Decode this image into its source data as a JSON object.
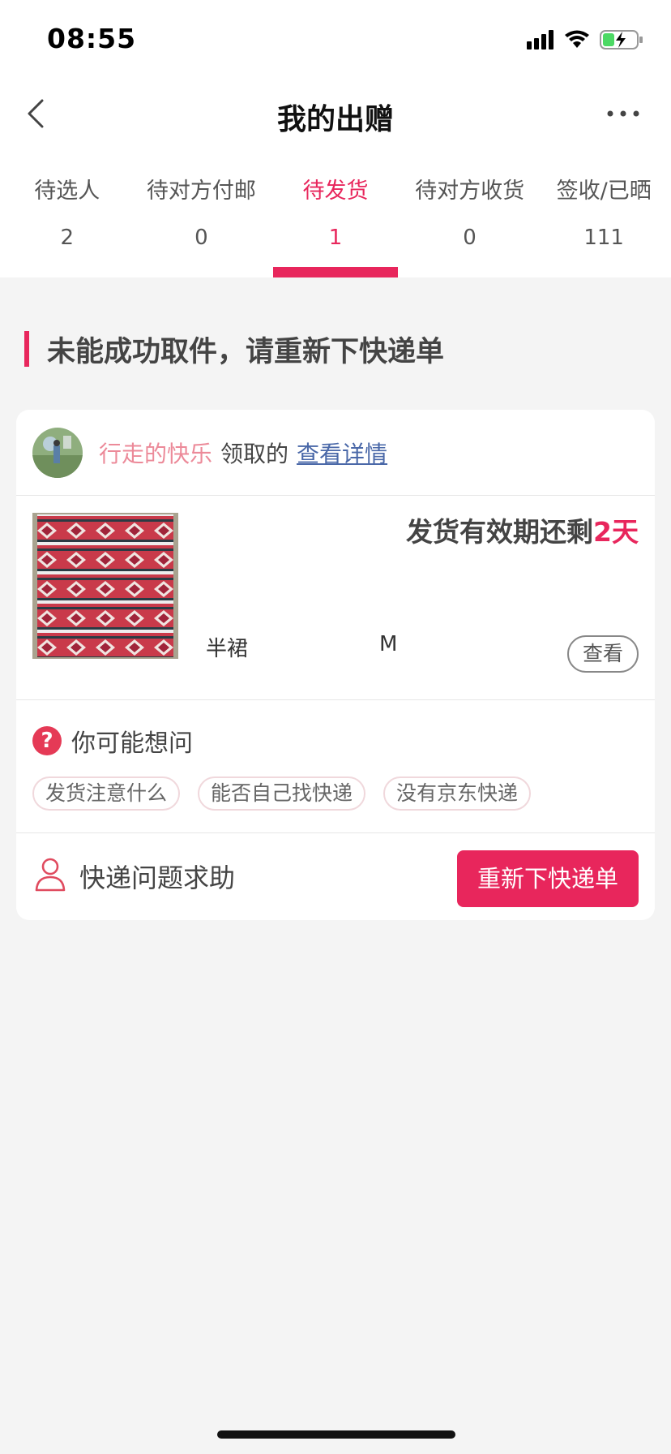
{
  "status_bar": {
    "time": "08:55"
  },
  "nav": {
    "title": "我的出赠"
  },
  "tabs": [
    {
      "label": "待选人",
      "count": "2"
    },
    {
      "label": "待对方付邮",
      "count": "0"
    },
    {
      "label": "待发货",
      "count": "1"
    },
    {
      "label": "待对方收货",
      "count": "0"
    },
    {
      "label": "签收/已晒",
      "count": "111"
    }
  ],
  "active_tab": 2,
  "notice": {
    "title": "未能成功取件，请重新下快递单"
  },
  "card": {
    "user_name": "行走的快乐",
    "received_text": "领取的",
    "detail_link": "查看详情",
    "deadline_prefix": "发货有效期还剩",
    "deadline_days": "2天",
    "item_category": "半裙",
    "item_size": "M",
    "view_button": "查看",
    "faq_title": "你可能想问",
    "faq_chips": [
      "发货注意什么",
      "能否自己找快递",
      "没有京东快递"
    ],
    "help_text": "快递问题求助",
    "reorder_button": "重新下快递单"
  },
  "colors": {
    "accent": "#e8265c",
    "username": "#ec8a99",
    "link": "#4a68a8",
    "background": "#f4f4f4"
  },
  "icons": {
    "back": "chevron-left-icon",
    "more": "more-dots-icon",
    "question": "question-circle-icon",
    "person": "person-icon"
  }
}
